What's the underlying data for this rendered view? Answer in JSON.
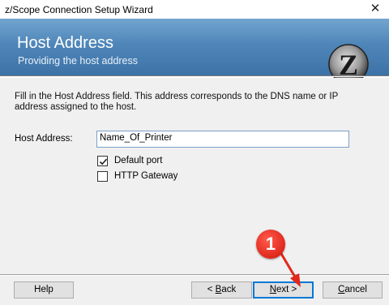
{
  "window": {
    "title": "z/Scope Connection Setup Wizard",
    "close_glyph": "✕"
  },
  "banner": {
    "title": "Host Address",
    "subtitle": "Providing the host address",
    "logo_letter": "Z",
    "logo_text": "scope"
  },
  "content": {
    "description": "Fill in the Host Address field. This address corresponds to the DNS name or IP address assigned to the host.",
    "host_label": "Host Address:",
    "host_value": "Name_Of_Printer",
    "default_port_label": "Default port",
    "default_port_checked": true,
    "http_gateway_label": "HTTP Gateway",
    "http_gateway_checked": false
  },
  "buttons": {
    "help": "Help",
    "back_prefix": "< ",
    "back_mnemonic": "B",
    "back_rest": "ack",
    "next_mnemonic": "N",
    "next_rest": "ext >",
    "cancel_mnemonic": "C",
    "cancel_rest": "ancel"
  },
  "annotation": {
    "step_number": "1",
    "color": "#e0281c"
  },
  "colors": {
    "banner": "#4f86b9",
    "accent": "#0078d7"
  }
}
